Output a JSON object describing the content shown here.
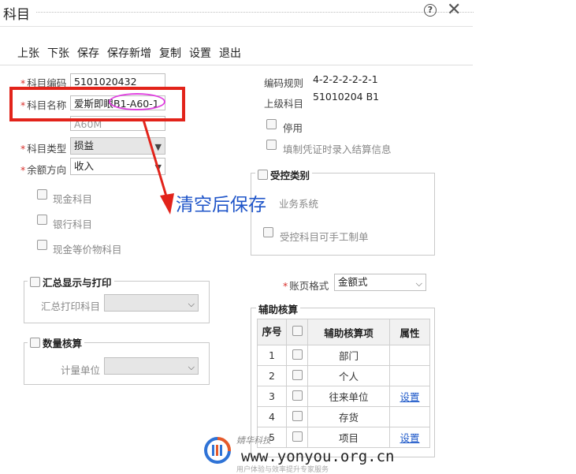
{
  "window": {
    "title": "科目",
    "help_icon": "question-circle-icon",
    "close_icon": "close-icon"
  },
  "toolbar": [
    "上张",
    "下张",
    "保存",
    "保存新增",
    "复制",
    "设置",
    "退出"
  ],
  "form": {
    "code": {
      "label": "科目编码",
      "value": "5101020432"
    },
    "name": {
      "label": "科目名称",
      "value": "爱斯即眼B1-A60-1"
    },
    "mnemonic_partial": "A60M",
    "type": {
      "label": "科目类型",
      "value": "损益"
    },
    "direction": {
      "label": "余额方向",
      "value": "收入"
    },
    "cash": "现金科目",
    "bank": "银行科目",
    "cash_equiv": "现金等价物科目",
    "coding_rule": {
      "label": "编码规则",
      "value": "4-2-2-2-2-2-1"
    },
    "parent": {
      "label": "上级科目",
      "value": "51010204 B1"
    },
    "disabled": "停用",
    "settle": "填制凭证时录入结算信息",
    "controlled": {
      "legend": "受控类别",
      "business_system": "业务系统",
      "manual": "受控科目可手工制单"
    },
    "summary_print": {
      "legend": "汇总显示与打印",
      "label": "汇总打印科目"
    },
    "quantity": {
      "legend": "数量核算",
      "label": "计量单位"
    },
    "ledger_format": {
      "label": "账页格式",
      "value": "金额式"
    }
  },
  "aux": {
    "legend": "辅助核算",
    "headers": [
      "序号",
      "辅助核算项",
      "属性"
    ],
    "rows": [
      {
        "no": "1",
        "item": "部门",
        "attr": ""
      },
      {
        "no": "2",
        "item": "个人",
        "attr": ""
      },
      {
        "no": "3",
        "item": "往来单位",
        "attr": "设置"
      },
      {
        "no": "4",
        "item": "存货",
        "attr": ""
      },
      {
        "no": "5",
        "item": "项目",
        "attr": "设置"
      }
    ]
  },
  "annotation": {
    "text": "清空后保存"
  },
  "watermark": {
    "site": "www.yonyou.org.cn",
    "brand": "婧华科技",
    "sub": "用户体验与效率提升专家服务"
  },
  "colors": {
    "annotation_red": "#e2231a",
    "annotation_blue": "#1f55c9",
    "highlight_magenta": "#e040e0",
    "link": "#1a56c8"
  }
}
